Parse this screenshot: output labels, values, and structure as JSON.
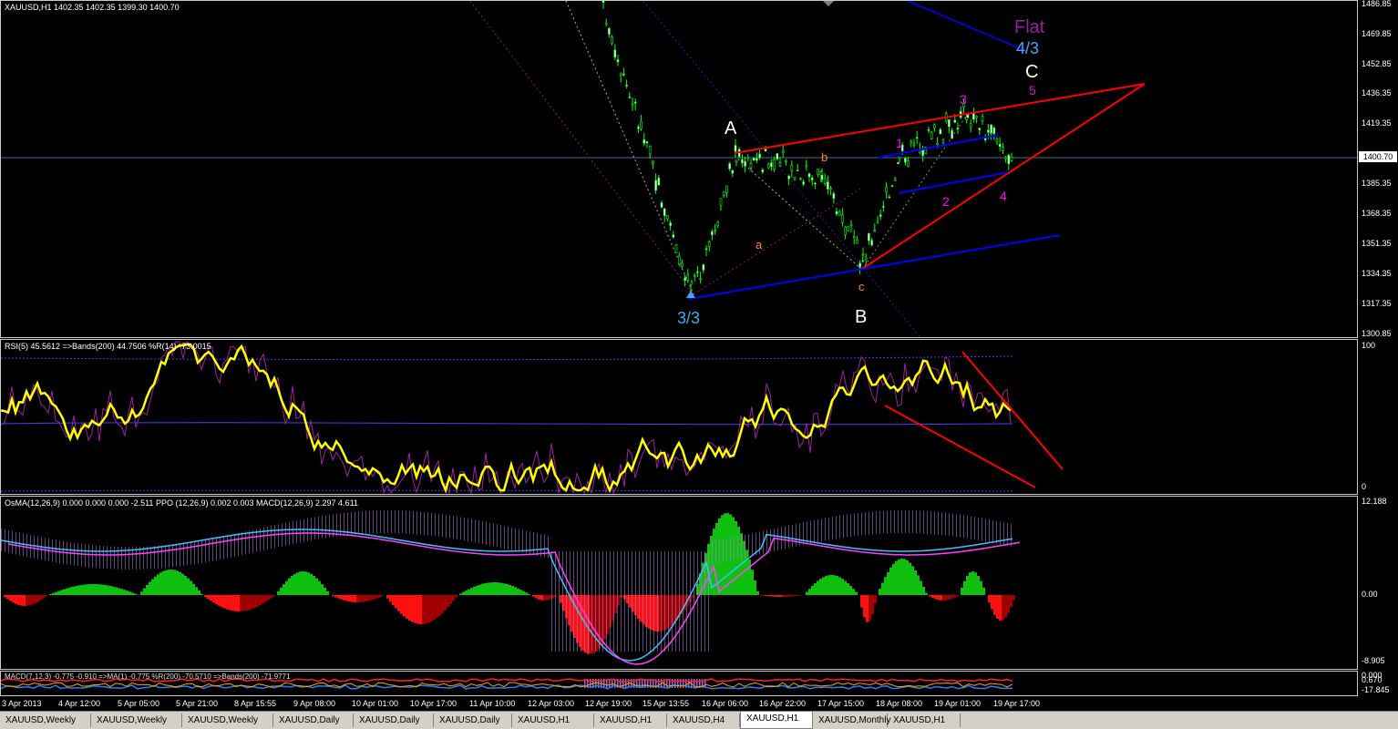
{
  "colors": {
    "background": "#000000",
    "candle": "#00ff00",
    "wave_line": "#ff0000",
    "channel": "#0000ff",
    "rsi": "#ffff00",
    "histogram_up": "#00c000",
    "histogram_down": "#ff0000",
    "wave_magenta": "#ff00ff",
    "wave_orange": "#ff8c00",
    "wave_cyan": "#3fa9f5",
    "flat_purple": "#9b1aa3"
  },
  "main": {
    "title": "XAUUSD,H1  1402.35 1402.35 1399.30 1400.70",
    "price_labels": [
      "1486.85",
      "1469.85",
      "1452.85",
      "1436.35",
      "1419.35",
      "1385.35",
      "1368.35",
      "1351.35",
      "1334.35",
      "1317.35",
      "1300.85"
    ],
    "current_price": "1400.70",
    "wave_labels": {
      "A": "A",
      "B": "B",
      "C": "C",
      "a": "a",
      "b": "b",
      "c": "c",
      "n1": "1",
      "n2": "2",
      "n3": "3",
      "n4": "4",
      "n5": "5",
      "three_three": "3/3",
      "four_three": "4/3",
      "flat": "Flat"
    }
  },
  "rsi_pane": {
    "title": "RSI(5) 45.5612  =>Bands(200) 44.7506  %R(14) -73.0015",
    "top": "100",
    "bottom": "0"
  },
  "macd_pane": {
    "title": "OsMA(12,26,9) 0.000 0.000 0.000 -2.511  PPO (12,26,9) 0.002 0.003  MACD(12,26,9) 2.297 4.611",
    "top": "12.188",
    "mid": "0.00",
    "bottom": "-8.905"
  },
  "small_pane": {
    "title": "MACD(7,12,3) -0.775 -0.910  =>MA(1) -0.775  %R(200) -70.5710  =>Bands(200) -71.9771",
    "top1": "0.000",
    "top2": "0.670",
    "bottom": "-17.845"
  },
  "time_labels": [
    "3 Apr 2013",
    "4 Apr 12:00",
    "5 Apr 05:00",
    "5 Apr 21:00",
    "8 Apr 15:55",
    "9 Apr 08:00",
    "10 Apr 01:00",
    "10 Apr 17:00",
    "11 Apr 10:00",
    "12 Apr 03:00",
    "12 Apr 19:00",
    "15 Apr 13:55",
    "16 Apr 06:00",
    "16 Apr 22:00",
    "17 Apr 15:00",
    "18 Apr 08:00",
    "19 Apr 01:00",
    "19 Apr 17:00"
  ],
  "tabs": [
    {
      "label": "XAUUSD,Weekly",
      "active": false
    },
    {
      "label": "XAUUSD,Weekly",
      "active": false
    },
    {
      "label": "XAUUSD,Weekly",
      "active": false
    },
    {
      "label": "XAUUSD,Daily",
      "active": false
    },
    {
      "label": "XAUUSD,Daily",
      "active": false
    },
    {
      "label": "XAUUSD,Daily",
      "active": false
    },
    {
      "label": "XAUUSD,H1",
      "active": false
    },
    {
      "label": "XAUUSD,H1",
      "active": false
    },
    {
      "label": "XAUUSD,H4",
      "active": false
    },
    {
      "label": "XAUUSD,H1",
      "active": true
    },
    {
      "label": "XAUUSD,Monthly",
      "active": false
    },
    {
      "label": "XAUUSD,H1",
      "active": false
    }
  ],
  "chart_data": {
    "type": "line",
    "title": "XAUUSD,H1  1402.35 1402.35 1399.30 1400.70",
    "xlabel": "",
    "ylabel": "",
    "ylim": [
      1300.85,
      1486.85
    ],
    "grid": false,
    "series": [
      {
        "name": "XAUUSD,H1",
        "x": [
          "12 Apr 19:00",
          "15 Apr 13:55",
          "16 Apr 06:00",
          "16 Apr 22:00",
          "17 Apr 15:00",
          "18 Apr 08:00",
          "19 Apr 01:00",
          "19 Apr 17:00"
        ],
        "values": [
          1486,
          1322,
          1402,
          1390,
          1340,
          1400,
          1425,
          1400.7
        ]
      }
    ]
  }
}
